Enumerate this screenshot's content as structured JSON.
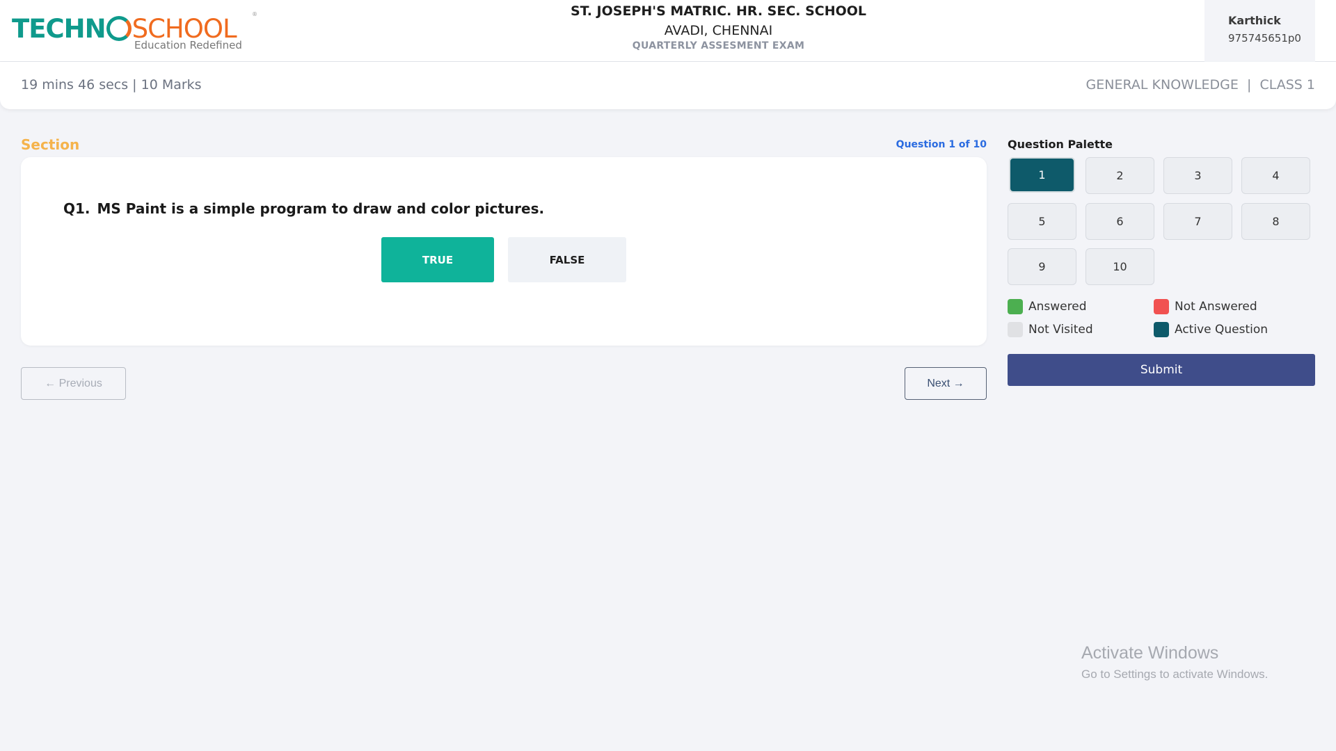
{
  "header": {
    "logo": {
      "brand_left": "TECHN",
      "brand_right": "SCHOOL",
      "tagline": "Education Redefined",
      "registered": "®"
    },
    "school_name": "ST. JOSEPH'S MATRIC. HR. SEC. SCHOOL",
    "school_location": "AVADI, CHENNAI",
    "exam_name": "QUARTERLY ASSESMENT EXAM",
    "user": {
      "name": "Karthick",
      "id": "975745651p0"
    }
  },
  "infobar": {
    "timer_marks": "19 mins 46 secs | 10 Marks",
    "subject_class": "GENERAL KNOWLEDGE  |  CLASS 1"
  },
  "section": {
    "title": "Section",
    "question_count": "Question 1 of 10"
  },
  "question": {
    "number": "Q1.",
    "text": "MS Paint is a simple program to draw and color pictures.",
    "options": [
      {
        "label": "TRUE",
        "selected": true
      },
      {
        "label": "FALSE",
        "selected": false
      }
    ]
  },
  "navigation": {
    "previous_label": "← Previous",
    "next_label": "Next →"
  },
  "palette": {
    "title": "Question Palette",
    "items": [
      "1",
      "2",
      "3",
      "4",
      "5",
      "6",
      "7",
      "8",
      "9",
      "10"
    ],
    "active": "1",
    "legend": [
      {
        "label": "Answered",
        "color": "#4caf50"
      },
      {
        "label": "Not Answered",
        "color": "#f15151"
      },
      {
        "label": "Not Visited",
        "color": "#e0e1e4"
      },
      {
        "label": "Active Question",
        "color": "#0e5a6a"
      }
    ],
    "submit_label": "Submit"
  },
  "watermark": {
    "title": "Activate Windows",
    "subtitle": "Go to Settings to activate Windows."
  },
  "colors": {
    "accent_teal": "#0fb39a",
    "section_orange": "#f5b34c",
    "link_blue": "#2a6be0",
    "submit_blue": "#3f4d8a"
  }
}
